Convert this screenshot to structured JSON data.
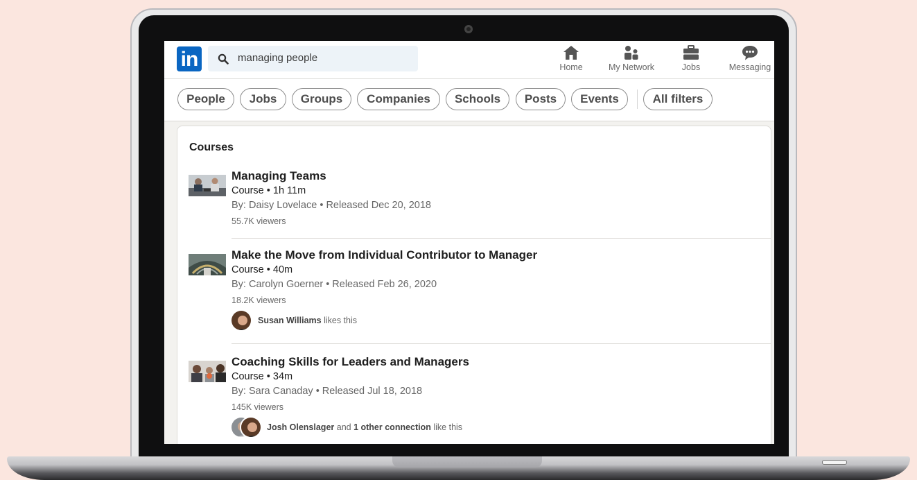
{
  "nav": {
    "search_value": "managing people",
    "items": [
      {
        "label": "Home",
        "icon": "home-icon"
      },
      {
        "label": "My Network",
        "icon": "network-icon"
      },
      {
        "label": "Jobs",
        "icon": "briefcase-icon"
      },
      {
        "label": "Messaging",
        "icon": "messaging-icon"
      }
    ]
  },
  "filters": [
    "People",
    "Jobs",
    "Groups",
    "Companies",
    "Schools",
    "Posts",
    "Events"
  ],
  "all_filters": "All filters",
  "courses": {
    "heading": "Courses",
    "items": [
      {
        "title": "Managing Teams",
        "meta": "Course • 1h 11m",
        "by": "By: Daisy Lovelace • Released Dec 20, 2018",
        "viewers": "55.7K viewers"
      },
      {
        "title": "Make the Move from Individual Contributor to Manager",
        "meta": "Course • 40m",
        "by": "By: Carolyn Goerner • Released Feb 26, 2020",
        "viewers": "18.2K viewers",
        "social_name": "Susan Williams",
        "social_rest": " likes this"
      },
      {
        "title": "Coaching Skills for Leaders and Managers",
        "meta": "Course • 34m",
        "by": "By: Sara Canaday • Released Jul 18, 2018",
        "viewers": "145K viewers",
        "social_name": "Josh Olenslager",
        "social_mid": " and ",
        "social_bold2": "1 other connection",
        "social_rest": " like this"
      }
    ]
  },
  "colors": {
    "brand": "#0a66c2",
    "background": "#fbe6df"
  }
}
